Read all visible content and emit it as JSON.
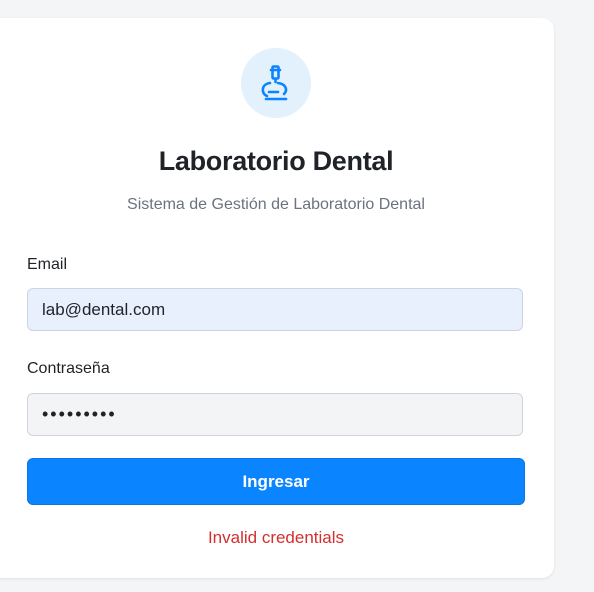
{
  "app": {
    "title": "Laboratorio Dental",
    "subtitle": "Sistema de Gestión de Laboratorio Dental",
    "logo_icon": "microscope-icon"
  },
  "form": {
    "email_label": "Email",
    "email_value": "lab@dental.com",
    "password_label": "Contraseña",
    "password_value": "password1",
    "submit_label": "Ingresar"
  },
  "status": {
    "error_message": "Invalid credentials"
  },
  "colors": {
    "accent": "#0a84ff",
    "logo_background": "#e3f1fd",
    "error": "#d32f2f"
  }
}
